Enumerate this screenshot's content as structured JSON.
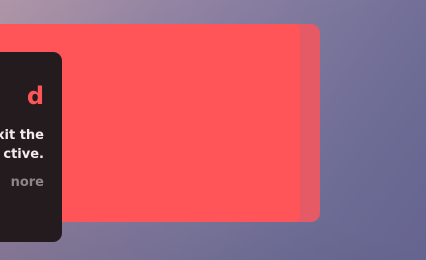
{
  "dialog": {
    "title": "d",
    "description_lines": [
      "xit the",
      "ctive."
    ],
    "link_label": "nore"
  },
  "colors": {
    "accent": "#ff5559",
    "panel": "#231b1e",
    "text": "#f3eced",
    "muted_text": "#8d8589"
  }
}
